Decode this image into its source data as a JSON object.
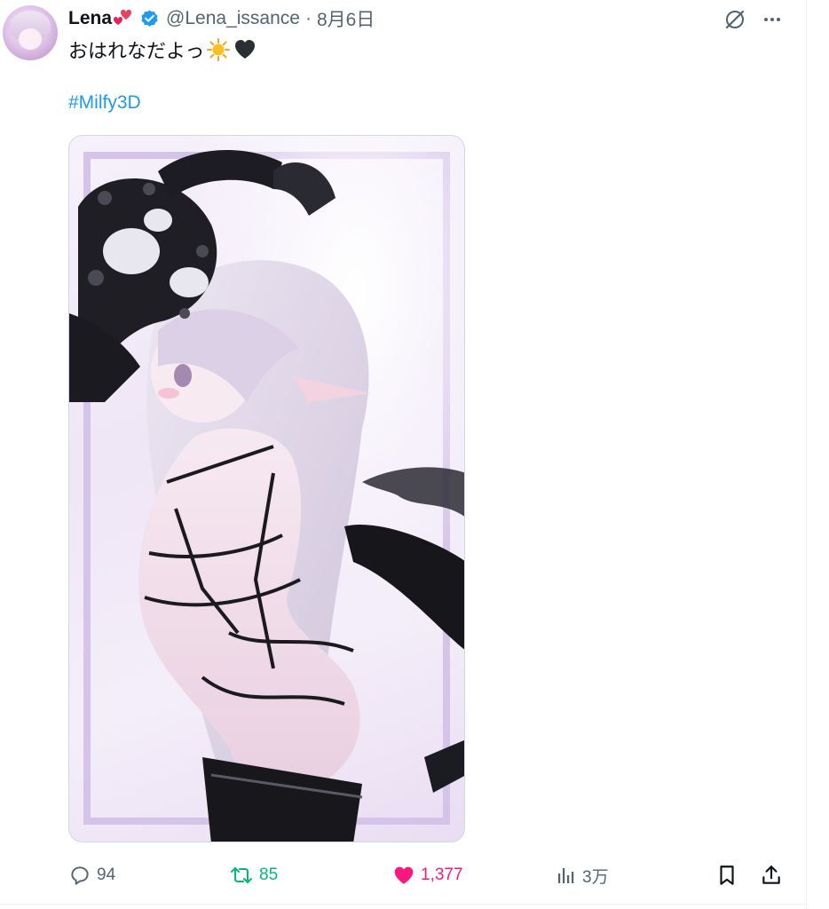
{
  "tweet": {
    "author_name": "Lena",
    "name_emoji_icon": "two-hearts-icon",
    "verified_icon": "verified-badge-icon",
    "handle": "@Lena_issance",
    "separator": "·",
    "date": "8月6日",
    "text": "おはれなだよっ",
    "text_emojis": [
      "sun-icon",
      "black-heart-icon"
    ],
    "hashtag": "#Milfy3D"
  },
  "header_icons": [
    "grok-icon",
    "more-icon"
  ],
  "media": {
    "description_icon": "photo"
  },
  "actions": {
    "reply_count": "94",
    "retweet_count": "85",
    "like_count": "1,377",
    "views_count": "3万"
  },
  "colors": {
    "text_primary": "#0f1419",
    "text_secondary": "#536471",
    "link": "#1d9bf0",
    "retweet": "#00ba7c",
    "like": "#f91880",
    "verified": "#1d9bf0"
  }
}
